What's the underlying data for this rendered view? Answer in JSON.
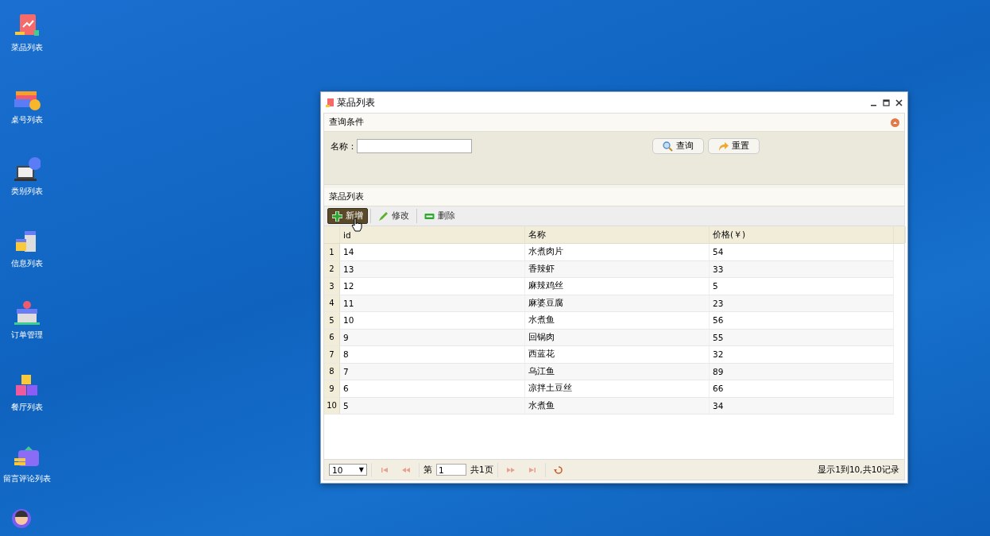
{
  "desktop_icons": [
    {
      "label": "菜品列表",
      "kind": "dish"
    },
    {
      "label": "桌号列表",
      "kind": "gift"
    },
    {
      "label": "类别列表",
      "kind": "laptop"
    },
    {
      "label": "信息列表",
      "kind": "building"
    },
    {
      "label": "订单管理",
      "kind": "shop"
    },
    {
      "label": "餐厅列表",
      "kind": "boxes"
    },
    {
      "label": "留言评论列表",
      "kind": "wallet"
    }
  ],
  "window": {
    "title": "菜品列表"
  },
  "query_panel": {
    "title": "查询条件",
    "field_label": "名称：",
    "buttons": [
      {
        "label": "查询",
        "kind": "search"
      },
      {
        "label": "重置",
        "kind": "reset"
      }
    ]
  },
  "list_panel": {
    "title": "菜品列表",
    "toolbar": [
      {
        "label": "新增",
        "kind": "add",
        "hovered": true
      },
      {
        "label": "修改",
        "kind": "edit",
        "hovered": false
      },
      {
        "label": "删除",
        "kind": "delete",
        "hovered": false
      }
    ],
    "columns": [
      "id",
      "名称",
      "价格(￥)"
    ],
    "rows": [
      {
        "num": "1",
        "cells": [
          "14",
          "水煮肉片",
          "54"
        ]
      },
      {
        "num": "2",
        "cells": [
          "13",
          "香辣虾",
          "33"
        ]
      },
      {
        "num": "3",
        "cells": [
          "12",
          "麻辣鸡丝",
          "5"
        ]
      },
      {
        "num": "4",
        "cells": [
          "11",
          "麻婆豆腐",
          "23"
        ]
      },
      {
        "num": "5",
        "cells": [
          "10",
          "水煮鱼",
          "56"
        ]
      },
      {
        "num": "6",
        "cells": [
          "9",
          "回锅肉",
          "55"
        ]
      },
      {
        "num": "7",
        "cells": [
          "8",
          "西蓝花",
          "32"
        ]
      },
      {
        "num": "8",
        "cells": [
          "7",
          "乌江鱼",
          "89"
        ]
      },
      {
        "num": "9",
        "cells": [
          "6",
          "凉拌土豆丝",
          "66"
        ]
      },
      {
        "num": "10",
        "cells": [
          "5",
          "水煮鱼",
          "34"
        ]
      }
    ]
  },
  "pager": {
    "page_size": "10",
    "caret": "▼",
    "before": "第",
    "page": "1",
    "after": "共1页",
    "summary": "显示1到10,共10记录"
  }
}
